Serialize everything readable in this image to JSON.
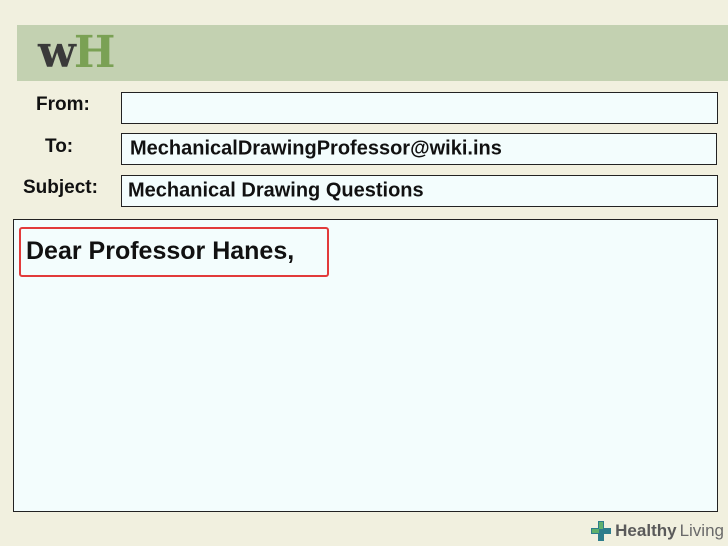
{
  "app": {
    "logo_w": "w",
    "logo_h": "H"
  },
  "email": {
    "from_label": "From:",
    "from_value": "",
    "to_label": "To:",
    "to_value": "MechanicalDrawingProfessor@wiki.ins",
    "subject_label": "Subject:",
    "subject_value": "Mechanical Drawing Questions",
    "body_greeting": "Dear Professor Hanes,"
  },
  "watermark": {
    "brand_bold": "Healthy",
    "brand_light": "Living",
    "icon": "medical-cross-icon"
  },
  "colors": {
    "background": "#f1f0df",
    "header_bar": "#c3d1b1",
    "field_fill": "#f3fdfd",
    "highlight_border": "#e23b3b",
    "logo_dark": "#3a3a3a",
    "logo_green": "#7aa154"
  }
}
